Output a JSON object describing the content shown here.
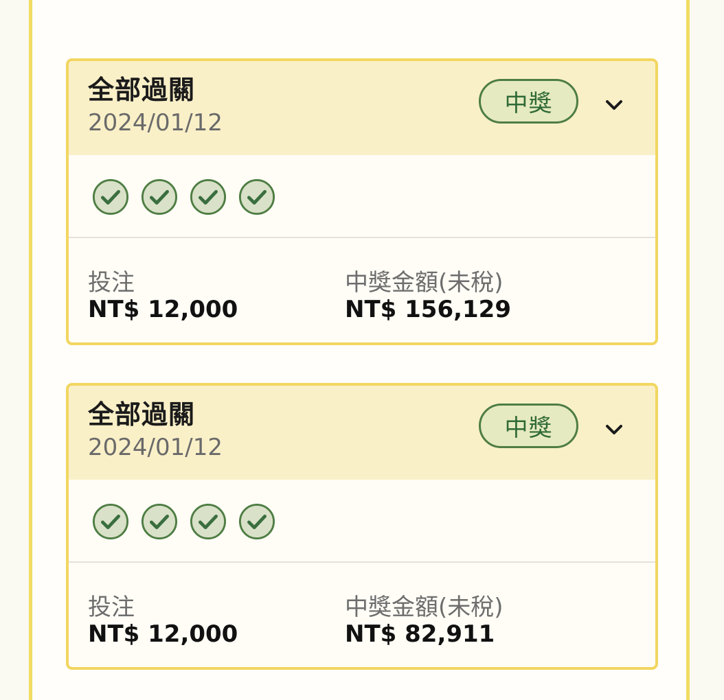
{
  "cards": [
    {
      "title": "全部過關",
      "date": "2024/01/12",
      "status": "中獎",
      "result_icons": [
        "check-icon",
        "check-icon",
        "check-icon",
        "check-icon"
      ],
      "stake_label": "投注",
      "stake_value": "NT$ 12,000",
      "prize_label": "中獎金額(未稅)",
      "prize_value": "NT$ 156,129"
    },
    {
      "title": "全部過關",
      "date": "2024/01/12",
      "status": "中獎",
      "result_icons": [
        "check-icon",
        "check-icon",
        "check-icon",
        "check-icon"
      ],
      "stake_label": "投注",
      "stake_value": "NT$ 12,000",
      "prize_label": "中獎金額(未稅)",
      "prize_value": "NT$ 82,911"
    }
  ],
  "colors": {
    "card_border": "#f2d660",
    "card_header_bg": "#faf0c8",
    "badge_bg": "#e6eac0",
    "badge_text": "#2f6a36",
    "check_green": "#4e7d43"
  }
}
